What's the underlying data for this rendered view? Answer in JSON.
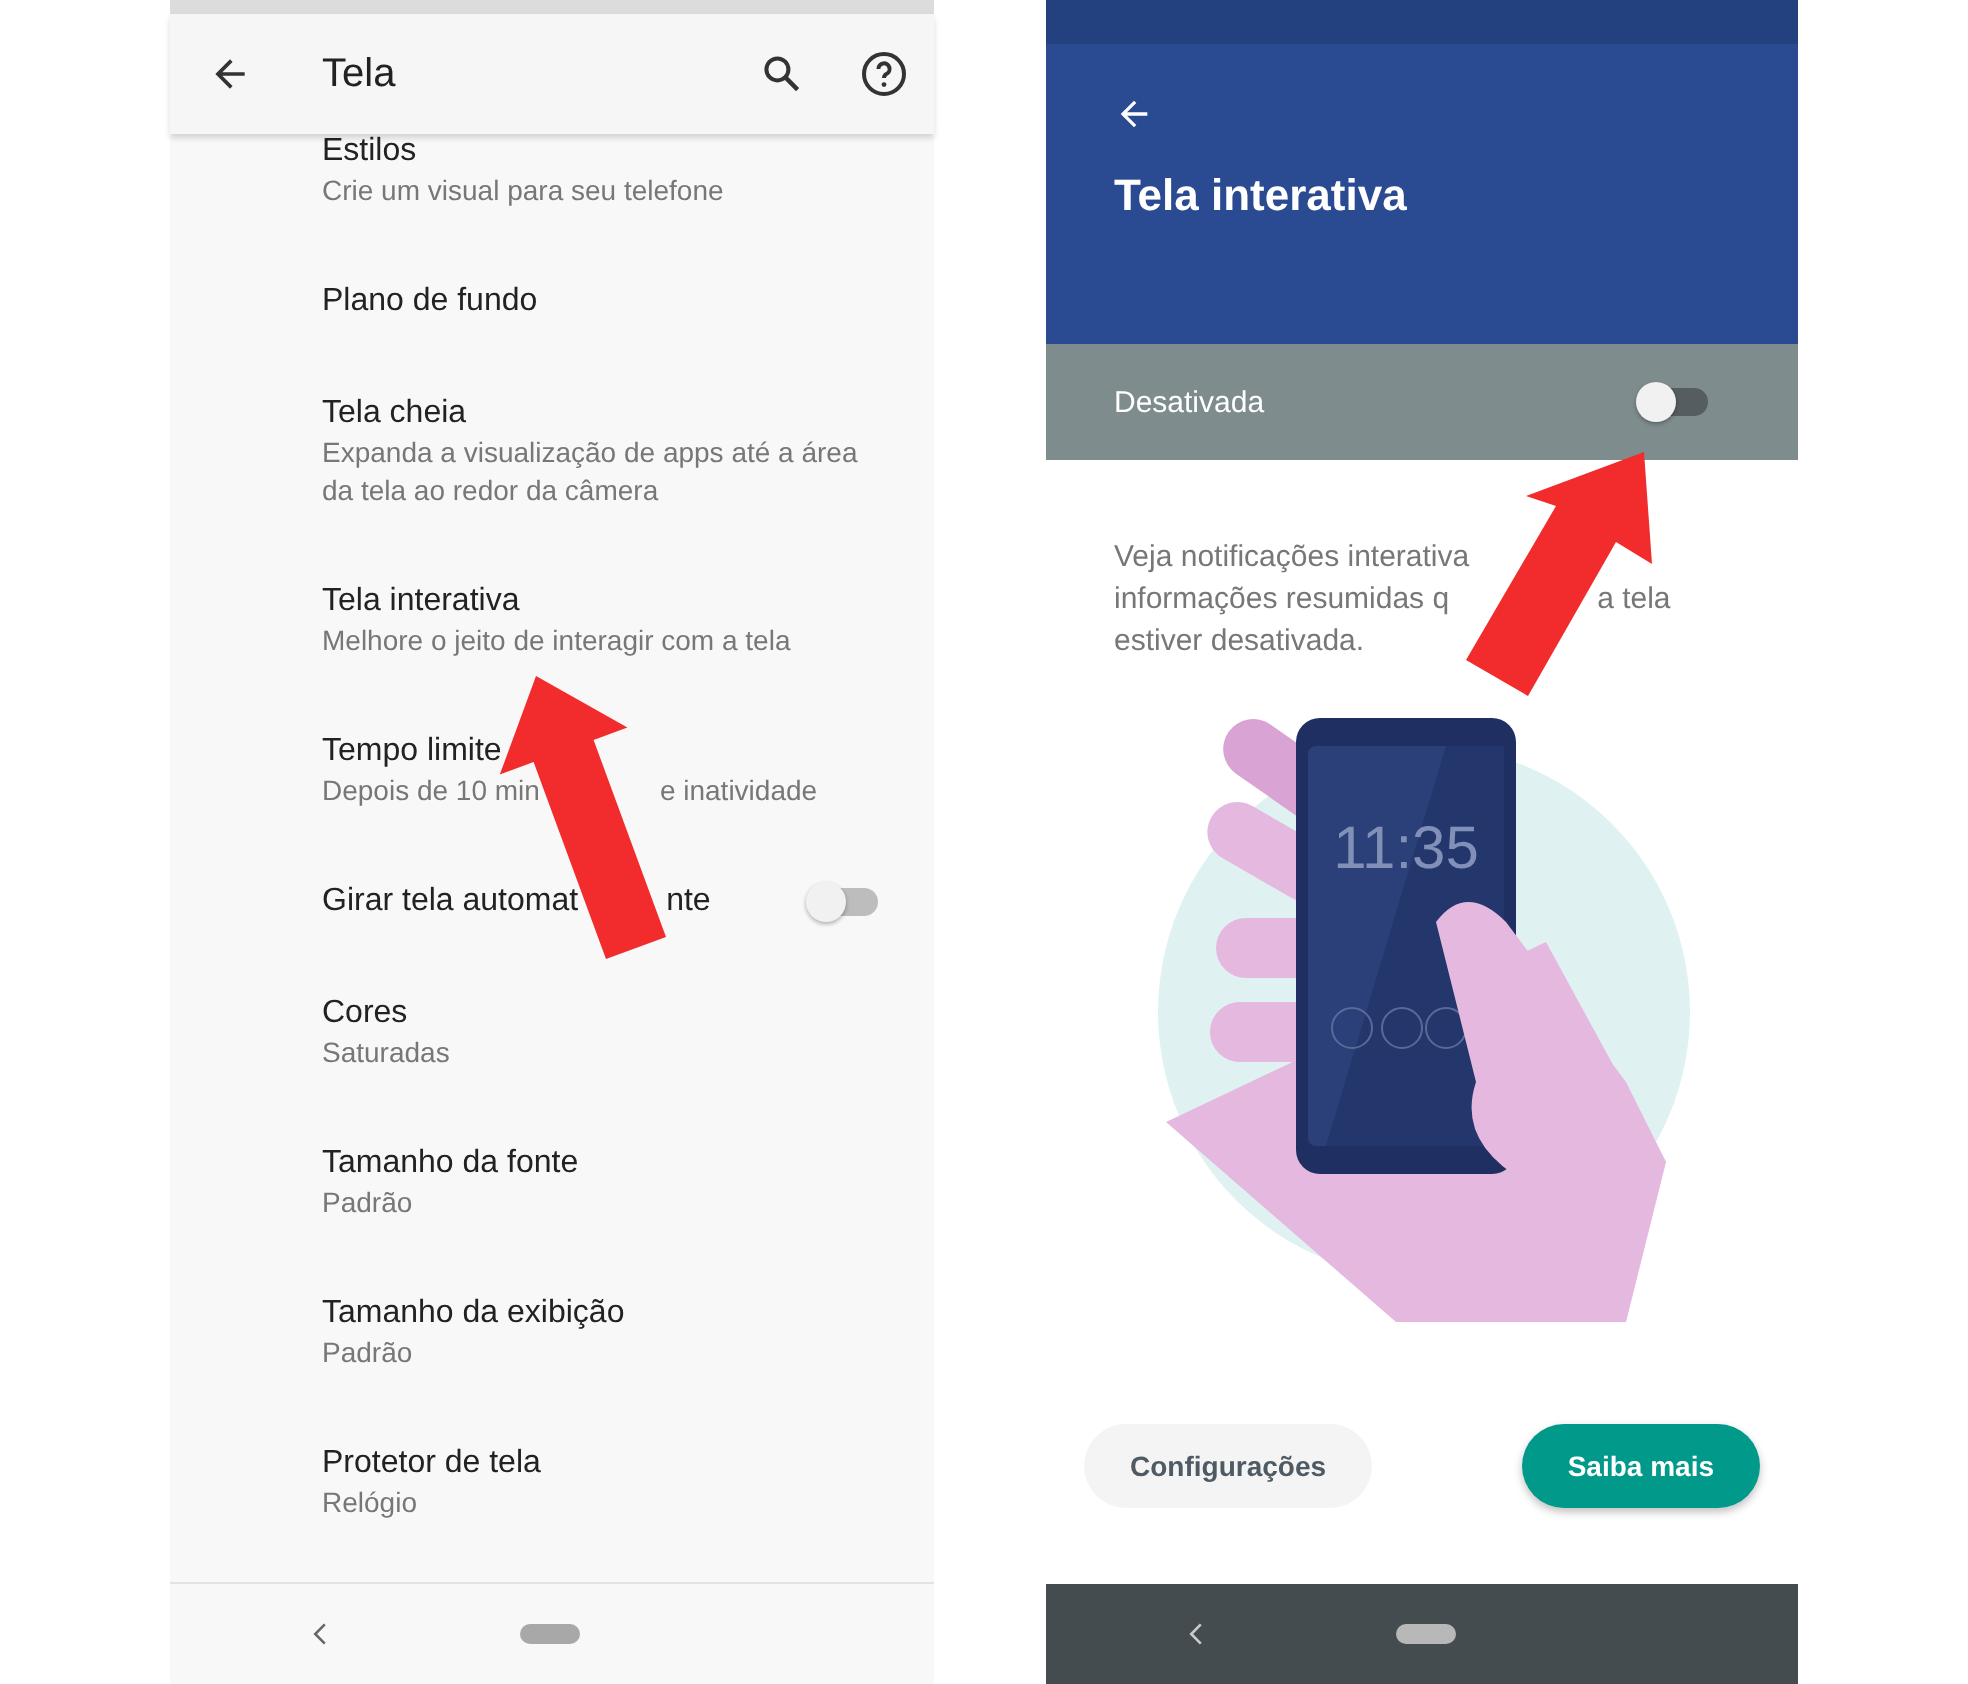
{
  "settings_screen": {
    "title": "Tela",
    "items": [
      {
        "kind": "text",
        "title": [
          "Estilos"
        ],
        "subtitle": [
          "Crie um visual para seu telefone"
        ]
      },
      {
        "kind": "text",
        "title": [
          "Plano de fundo"
        ]
      },
      {
        "kind": "text",
        "title": [
          "Tela cheia"
        ],
        "subtitle": [
          "Expanda a visualização de apps até a área da tela ao redor da câmera"
        ]
      },
      {
        "kind": "text",
        "title": [
          "Tela interativa"
        ],
        "subtitle": [
          "Melhore o jeito de interagir com a tela"
        ]
      },
      {
        "kind": "text",
        "title": [
          "Tempo limite"
        ],
        "subtitle": [
          "Depois de 10 min",
          "e inatividade"
        ]
      },
      {
        "kind": "toggle",
        "title": [
          "Girar tela automat",
          "nte"
        ],
        "on": false
      },
      {
        "kind": "text",
        "title": [
          "Cores"
        ],
        "subtitle": [
          "Saturadas"
        ]
      },
      {
        "kind": "text",
        "title": [
          "Tamanho da fonte"
        ],
        "subtitle": [
          "Padrão"
        ]
      },
      {
        "kind": "text",
        "title": [
          "Tamanho da exibição"
        ],
        "subtitle": [
          "Padrão"
        ]
      },
      {
        "kind": "text",
        "title": [
          "Protetor de tela"
        ],
        "subtitle": [
          "Relógio"
        ]
      }
    ]
  },
  "detail_screen": {
    "title": "Tela interativa",
    "switch_label": "Desativada",
    "on": false,
    "description": [
      [
        "Veja notificações interativa"
      ],
      [
        "informações resumidas q",
        "a tela"
      ],
      [
        "estiver desativada."
      ]
    ],
    "illustration_clock": "11:35",
    "buttons": [
      {
        "label": "Configurações",
        "kind": "secondary"
      },
      {
        "label": "Saiba mais",
        "kind": "primary"
      }
    ]
  }
}
